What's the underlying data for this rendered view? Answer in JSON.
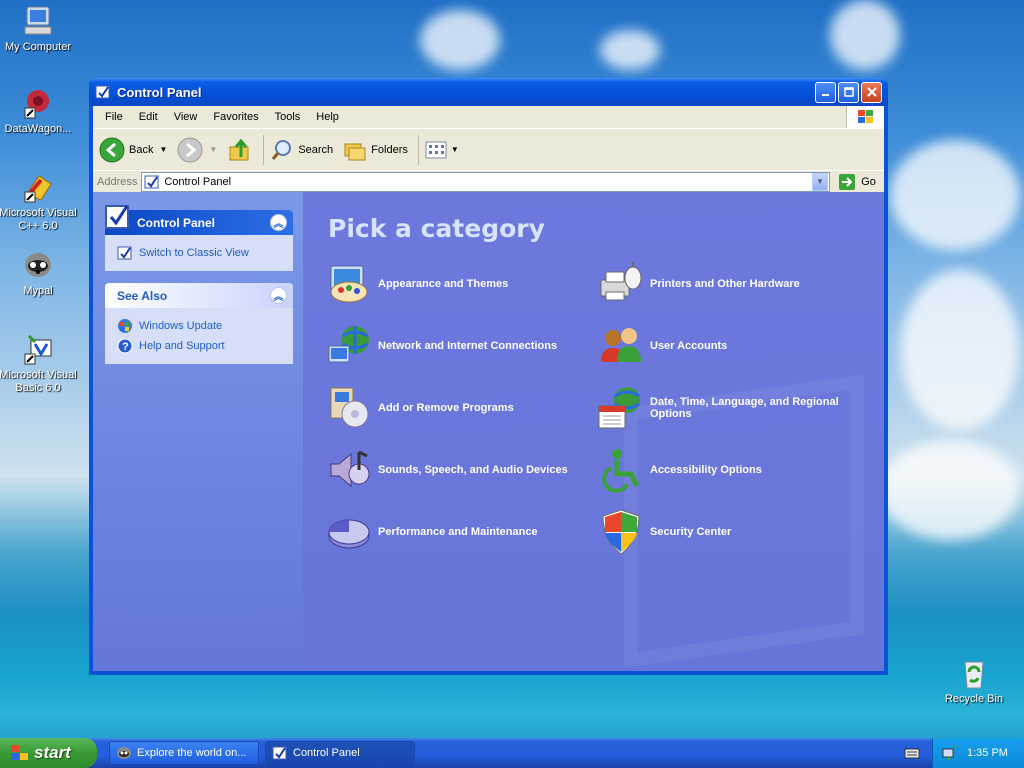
{
  "desktop": {
    "icons": [
      {
        "label": "My Computer",
        "icon": "my-computer-icon"
      },
      {
        "label": "DataWagon...",
        "icon": "datawagon-icon"
      },
      {
        "label": "Microsoft Visual C++ 6.0",
        "icon": "visual-cpp-icon"
      },
      {
        "label": "Mypal",
        "icon": "mypal-icon"
      },
      {
        "label": "Microsoft Visual Basic 6.0",
        "icon": "visual-basic-icon"
      },
      {
        "label": "Recycle Bin",
        "icon": "recycle-bin-icon"
      }
    ]
  },
  "window": {
    "title": "Control Panel",
    "menu": [
      "File",
      "Edit",
      "View",
      "Favorites",
      "Tools",
      "Help"
    ],
    "toolbar": {
      "back": "Back",
      "search": "Search",
      "folders": "Folders"
    },
    "address": {
      "label": "Address",
      "value": "Control Panel",
      "go": "Go"
    }
  },
  "sidebar": {
    "control_panel": {
      "title": "Control Panel",
      "link": "Switch to Classic View"
    },
    "see_also": {
      "title": "See Also",
      "links": [
        "Windows Update",
        "Help and Support"
      ]
    }
  },
  "main": {
    "heading": "Pick a category",
    "categories": [
      "Appearance and Themes",
      "Printers and Other Hardware",
      "Network and Internet Connections",
      "User Accounts",
      "Add or Remove Programs",
      "Date, Time, Language, and Regional Options",
      "Sounds, Speech, and Audio Devices",
      "Accessibility Options",
      "Performance and Maintenance",
      "Security Center"
    ]
  },
  "taskbar": {
    "start": "start",
    "tasks": [
      "Explore the world on...",
      "Control Panel"
    ],
    "clock": "1:35 PM"
  },
  "colors": {
    "xp_blue": "#0a53d8",
    "category_bg": "#6d78dd",
    "start_green": "#3a9a35"
  }
}
